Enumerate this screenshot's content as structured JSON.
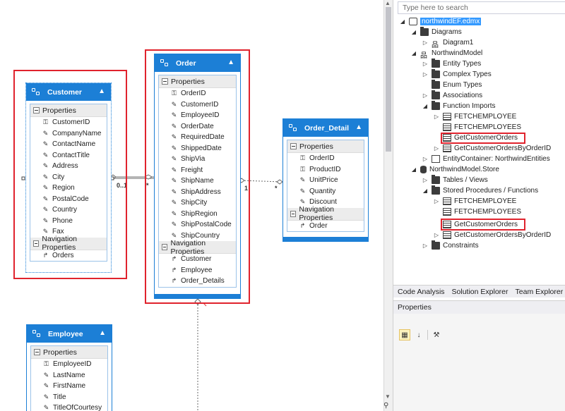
{
  "customer": {
    "title": "Customer",
    "properties_label": "Properties",
    "properties": [
      "CustomerID",
      "CompanyName",
      "ContactName",
      "ContactTitle",
      "Address",
      "City",
      "Region",
      "PostalCode",
      "Country",
      "Phone",
      "Fax"
    ],
    "nav_label": "Navigation Properties",
    "nav": [
      "Orders"
    ]
  },
  "order": {
    "title": "Order",
    "properties_label": "Properties",
    "properties": [
      "OrderID",
      "CustomerID",
      "EmployeeID",
      "OrderDate",
      "RequiredDate",
      "ShippedDate",
      "ShipVia",
      "Freight",
      "ShipName",
      "ShipAddress",
      "ShipCity",
      "ShipRegion",
      "ShipPostalCode",
      "ShipCountry"
    ],
    "nav_label": "Navigation Properties",
    "nav": [
      "Customer",
      "Employee",
      "Order_Details"
    ]
  },
  "order_detail": {
    "title": "Order_Detail",
    "properties_label": "Properties",
    "properties": [
      "OrderID",
      "ProductID",
      "UnitPrice",
      "Quantity",
      "Discount"
    ],
    "nav_label": "Navigation Properties",
    "nav": [
      "Order"
    ]
  },
  "employee": {
    "title": "Employee",
    "properties_label": "Properties",
    "properties": [
      "EmployeeID",
      "LastName",
      "FirstName",
      "Title",
      "TitleOfCourtesy"
    ]
  },
  "multiplicities": {
    "cust_order_left": "0..1",
    "cust_order_right": "*",
    "order_detail_left": "1",
    "order_detail_right": "*"
  },
  "search": {
    "placeholder": "Type here to search"
  },
  "tree": {
    "root": "northwindEF.edmx",
    "diagrams": "Diagrams",
    "diagram1": "Diagram1",
    "model": "NorthwindModel",
    "entity_types": "Entity Types",
    "complex_types": "Complex Types",
    "enum_types": "Enum Types",
    "associations": "Associations",
    "function_imports": "Function Imports",
    "fi_items": [
      "FETCHEMPLOYEE",
      "FETCHEMPLOYEES",
      "GetCustomerOrders",
      "GetCustomerOrdersByOrderID"
    ],
    "entity_container": "EntityContainer: NorthwindEntities",
    "store": "NorthwindModel.Store",
    "tables_views": "Tables / Views",
    "stored_procs": "Stored Procedures / Functions",
    "sp_items": [
      "FETCHEMPLOYEE",
      "FETCHEMPLOYEES",
      "GetCustomerOrders",
      "GetCustomerOrdersByOrderID"
    ],
    "constraints": "Constraints"
  },
  "tabs": [
    "Code Analysis",
    "Solution Explorer",
    "Team Explorer",
    "Cl"
  ],
  "properties_panel": {
    "title": "Properties"
  },
  "colors": {
    "entity_header": "#1c7fd6",
    "highlight_red": "#e0232d",
    "selection": "#3399ff"
  }
}
